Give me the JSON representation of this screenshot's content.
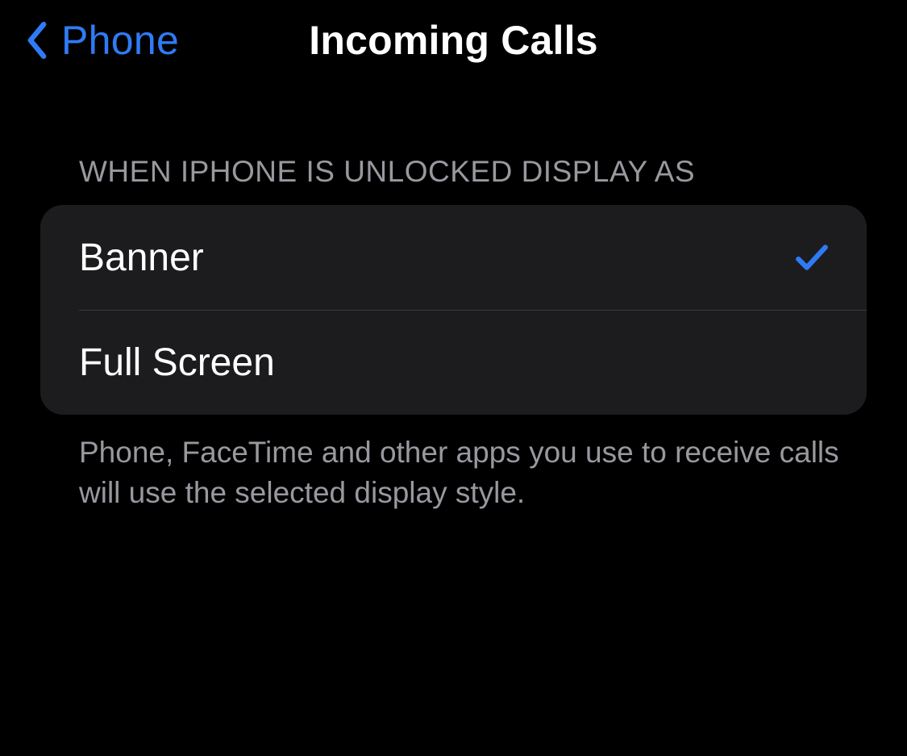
{
  "nav": {
    "back_label": "Phone",
    "title": "Incoming Calls"
  },
  "section": {
    "header": "WHEN IPHONE IS UNLOCKED DISPLAY AS",
    "footer": "Phone, FaceTime and other apps you use to receive calls will use the selected display style.",
    "options": [
      {
        "label": "Banner",
        "selected": true
      },
      {
        "label": "Full Screen",
        "selected": false
      }
    ]
  },
  "colors": {
    "accent": "#2f7bf6",
    "background": "#000000",
    "cell": "#1c1c1e",
    "secondary_text": "#98989f"
  }
}
